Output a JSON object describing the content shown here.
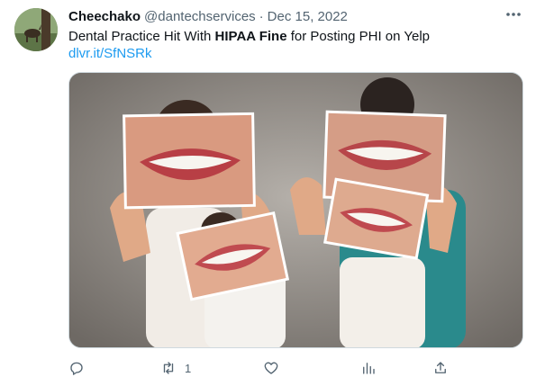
{
  "tweet": {
    "author_name": "Cheechako",
    "author_handle": "@dantechservices",
    "separator": "·",
    "date": "Dec 15, 2022",
    "text_before": "Dental Practice Hit With ",
    "text_bold": "HIPAA Fine",
    "text_after": " for Posting PHI on Yelp",
    "link": "dlvr.it/SfNSRk"
  },
  "actions": {
    "reply_count": "",
    "retweet_count": "1",
    "like_count": ""
  },
  "icons": [
    "more-icon",
    "reply-icon",
    "retweet-icon",
    "like-icon",
    "views-icon",
    "share-icon"
  ],
  "colors": {
    "link": "#1d9bf0",
    "secondary_text": "#536471",
    "primary_text": "#0f1419"
  }
}
